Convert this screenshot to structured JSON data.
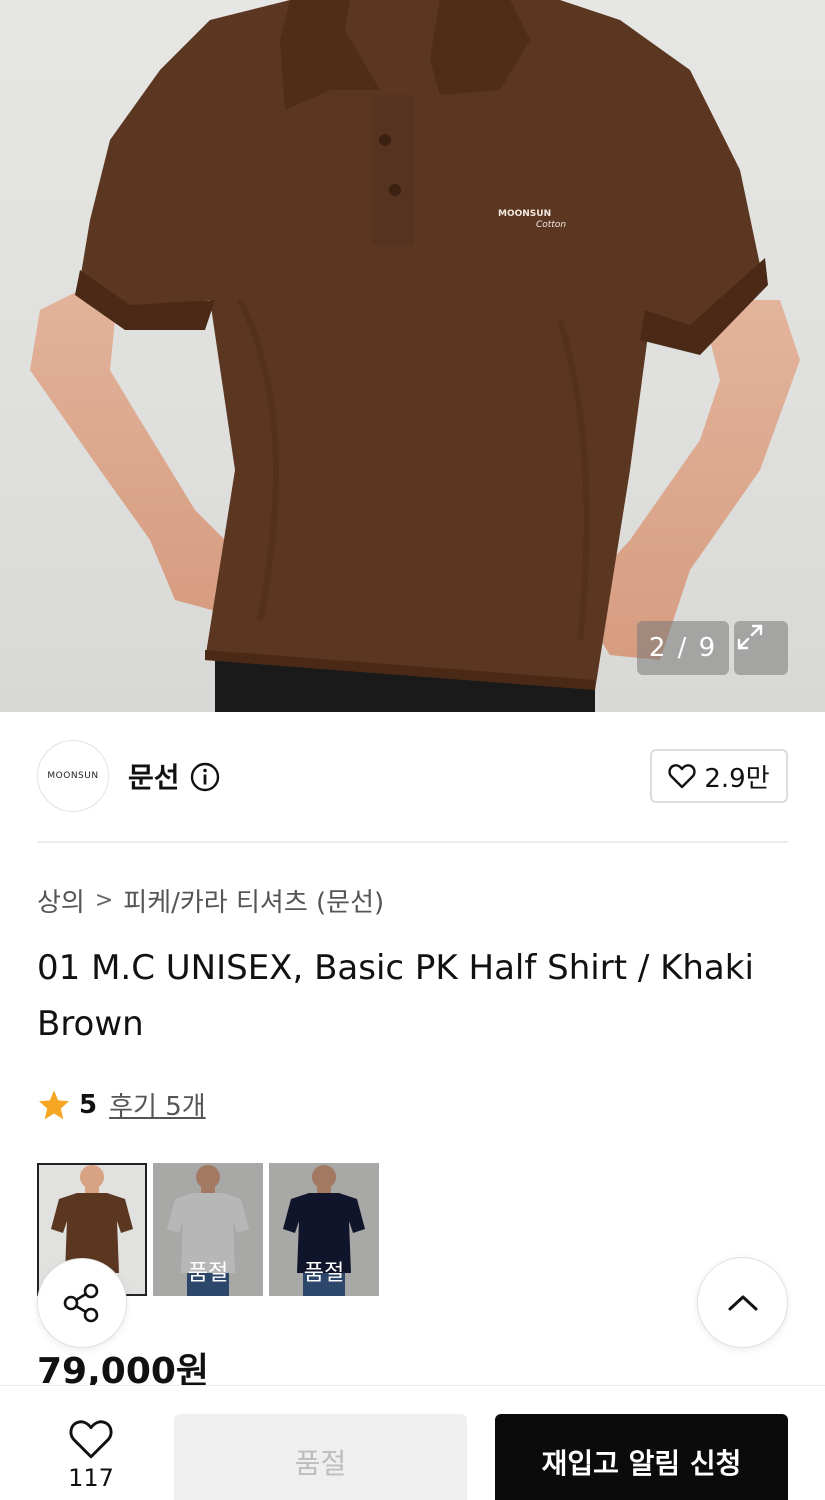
{
  "hero": {
    "counter": "2 / 9",
    "icons": {
      "expand": "expand-arrows-icon"
    },
    "shirt_logo_lines": [
      "MOONSUN",
      "Cotton"
    ]
  },
  "brand": {
    "logo_text": "MOONSUN",
    "name": "문선",
    "likes": "2.9만",
    "icons": {
      "info": "info-icon",
      "like": "heart-outline-icon"
    }
  },
  "breadcrumb": {
    "category": "상의",
    "separator": ">",
    "subcategory": "피케/카라 티셔츠 (문선)"
  },
  "product": {
    "title": "01 M.C UNISEX, Basic PK Half Shirt / Khaki Brown",
    "rating_score": "5",
    "reviews_label": "후기 5개",
    "price": "79,000원"
  },
  "color_options": [
    {
      "name": "brown",
      "color": "#5a3420",
      "sold_out_label": ""
    },
    {
      "name": "white",
      "color": "#f2f2f2",
      "sold_out_label": "품절"
    },
    {
      "name": "navy",
      "color": "#171c3a",
      "sold_out_label": "품절"
    }
  ],
  "bottom_bar": {
    "wish_count": "117",
    "soldout_label": "품절",
    "restock_label": "재입고 알림 신청"
  },
  "colors": {
    "shirt": "#5b3620",
    "star": "#f5a623",
    "primary_button": "#0b0b0b"
  }
}
